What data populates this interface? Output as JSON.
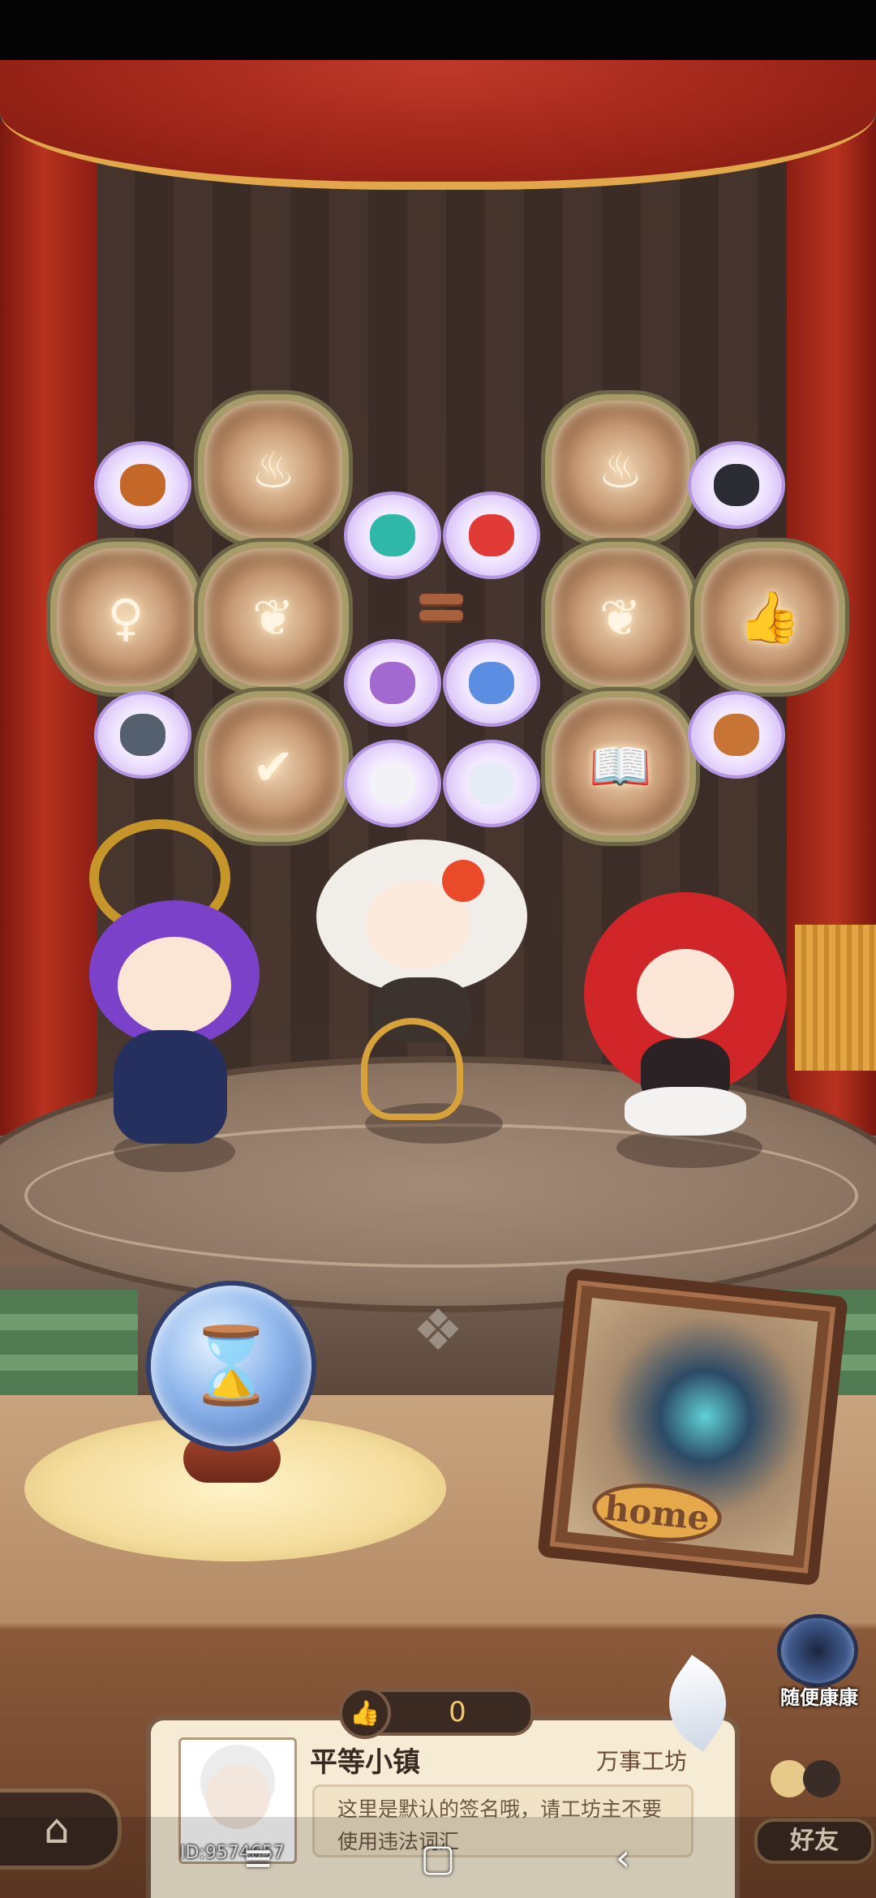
{
  "board": {
    "medallions": [
      {
        "name": "cauldron",
        "glyph": "♨"
      },
      {
        "name": "cauldron",
        "glyph": "♨"
      },
      {
        "name": "fairy",
        "glyph": "♀"
      },
      {
        "name": "ornament",
        "glyph": "❦"
      },
      {
        "name": "ornament",
        "glyph": "❦"
      },
      {
        "name": "thumbs-up",
        "glyph": "👍"
      },
      {
        "name": "scroll",
        "glyph": "✔"
      },
      {
        "name": "book",
        "glyph": "📖"
      }
    ],
    "items": [
      {
        "name": "copper-ore",
        "color": "#c4682a"
      },
      {
        "name": "coal",
        "color": "#2b2b33"
      },
      {
        "name": "teal-potion",
        "color": "#2fb7a8"
      },
      {
        "name": "tomato",
        "color": "#e03b36"
      },
      {
        "name": "purple-mushroom",
        "color": "#a269d1"
      },
      {
        "name": "blue-mushroom",
        "color": "#5b8de3"
      },
      {
        "name": "iron-ore",
        "color": "#55606e"
      },
      {
        "name": "copper-ingot",
        "color": "#c77434"
      },
      {
        "name": "cotton",
        "color": "#f2f2f7"
      },
      {
        "name": "crystal",
        "color": "#e6ecf5"
      }
    ]
  },
  "characters": [
    {
      "name": "purple-hair-girl",
      "hair": "#7b42c9",
      "outfit": "#26305e"
    },
    {
      "name": "white-hair-girl",
      "hair": "#f1eeea",
      "outfit": "#3c332e"
    },
    {
      "name": "red-hair-girl",
      "hair": "#d0262a",
      "outfit": "#2b2226"
    }
  ],
  "hourglass": {
    "icon": "hourglass-icon",
    "glyph": "⌛"
  },
  "home_sign": {
    "label": "home"
  },
  "portal": {
    "label": "随便康康"
  },
  "likes": {
    "count": "0"
  },
  "profile": {
    "town_name": "平等小镇",
    "tag": "万事工坊",
    "signature": "这里是默认的签名哦，请工坊主不要使用违法词汇",
    "uid": "ID:9574657"
  },
  "buttons": {
    "home_glyph": "⌂",
    "friends_label": "好友"
  },
  "system_nav": {
    "menu": "≡",
    "home": "▢",
    "back": "‹"
  }
}
